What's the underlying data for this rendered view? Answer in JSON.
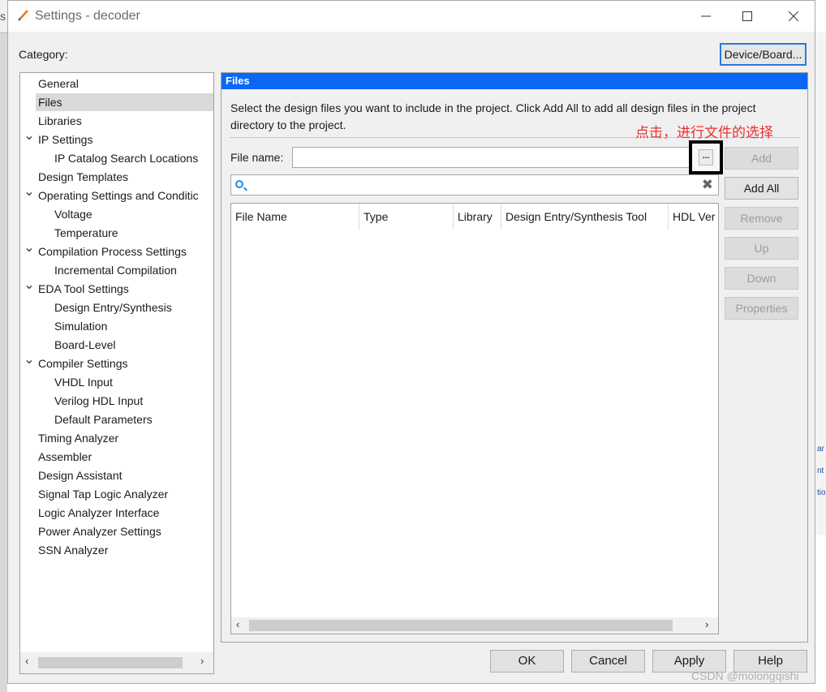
{
  "window": {
    "title": "Settings - decoder"
  },
  "category_label": "Category:",
  "device_board_label": "Device/Board...",
  "tree": [
    {
      "label": "General",
      "expanded": false
    },
    {
      "label": "Files",
      "selected": true
    },
    {
      "label": "Libraries"
    },
    {
      "label": "IP Settings",
      "expanded": true
    },
    {
      "label": "IP Catalog Search Locations"
    },
    {
      "label": "Design Templates"
    },
    {
      "label": "Operating Settings and Conditic",
      "expanded": true
    },
    {
      "label": "Voltage"
    },
    {
      "label": "Temperature"
    },
    {
      "label": "Compilation Process Settings",
      "expanded": true
    },
    {
      "label": "Incremental Compilation"
    },
    {
      "label": "EDA Tool Settings",
      "expanded": true
    },
    {
      "label": "Design Entry/Synthesis"
    },
    {
      "label": "Simulation"
    },
    {
      "label": "Board-Level"
    },
    {
      "label": "Compiler Settings",
      "expanded": true
    },
    {
      "label": "VHDL Input"
    },
    {
      "label": "Verilog HDL Input"
    },
    {
      "label": "Default Parameters"
    },
    {
      "label": "Timing Analyzer"
    },
    {
      "label": "Assembler"
    },
    {
      "label": "Design Assistant"
    },
    {
      "label": "Signal Tap Logic Analyzer"
    },
    {
      "label": "Logic Analyzer Interface"
    },
    {
      "label": "Power Analyzer Settings"
    },
    {
      "label": "SSN Analyzer"
    }
  ],
  "files": {
    "header": "Files",
    "description": "Select the design files you want to include in the project. Click Add All to add all design files in the project directory to the project.",
    "annotation": "点击，进行文件的选择",
    "file_name_label": "File name:",
    "file_name_value": "",
    "browse_label": "...",
    "filter_value": "",
    "columns": [
      "File Name",
      "Type",
      "Library",
      "Design Entry/Synthesis Tool",
      "HDL Ver"
    ],
    "buttons": {
      "add": "Add",
      "add_all": "Add All",
      "remove": "Remove",
      "up": "Up",
      "down": "Down",
      "properties": "Properties"
    }
  },
  "footer": {
    "ok": "OK",
    "cancel": "Cancel",
    "apply": "Apply",
    "help": "Help"
  },
  "background": {
    "left_fragment": "s",
    "right_fragments": [
      "ar",
      "nt",
      "tio"
    ]
  },
  "watermark": "CSDN @molongqishi"
}
